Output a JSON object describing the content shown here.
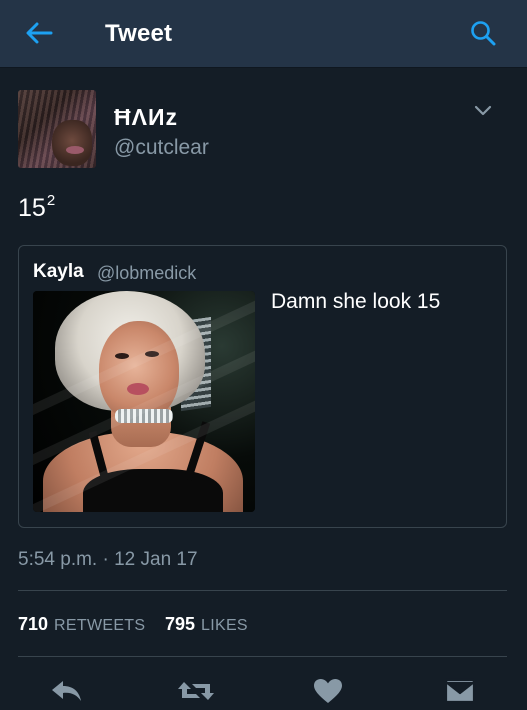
{
  "header": {
    "title": "Tweet",
    "back_icon": "arrow-left-icon",
    "search_icon": "search-icon",
    "accent": "#1da1f2",
    "background": "#243447"
  },
  "author": {
    "name": "ĦΛИz",
    "handle": "@cutclear"
  },
  "tweet": {
    "text": "15",
    "superscript": "2"
  },
  "quoted_tweet": {
    "name": "Kayla",
    "handle": "@lobmedick",
    "text": "Damn she look 15"
  },
  "timestamp": "5:54 p.m. · 12 Jan 17",
  "stats": {
    "retweets_count": "710",
    "retweets_label": "RETWEETS",
    "likes_count": "795",
    "likes_label": "LIKES"
  },
  "actions": {
    "reply_icon": "reply-icon",
    "retweet_icon": "retweet-icon",
    "like_icon": "heart-icon",
    "dm_icon": "direct-message-icon",
    "icon_color": "#8899a6"
  },
  "colors": {
    "page_background": "#141d26",
    "secondary_text": "#8899a6",
    "border": "#38444d"
  }
}
